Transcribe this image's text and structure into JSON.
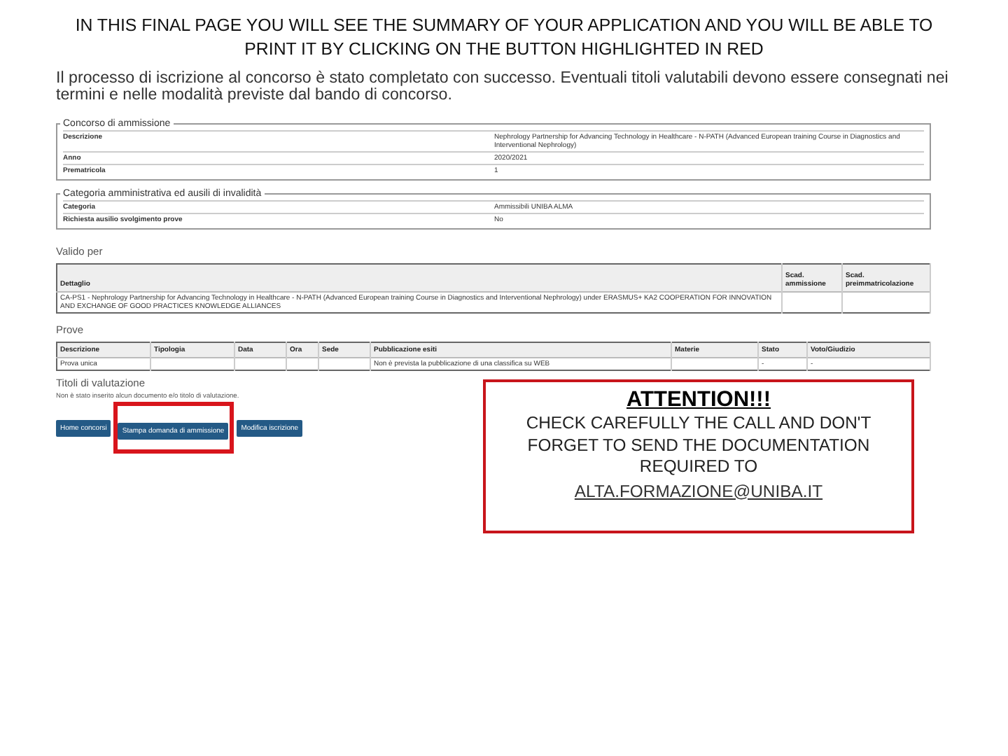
{
  "caption": "IN THIS FINAL PAGE YOU WILL SEE THE SUMMARY OF YOUR APPLICATION AND YOU WILL BE ABLE TO PRINT IT BY CLICKING ON THE BUTTON HIGHLIGHTED IN RED",
  "intro": "Il processo di iscrizione al concorso è stato completato con successo. Eventuali titoli valutabili devono essere consegnati nei termini e nelle modalità previste dal bando di concorso.",
  "panels": [
    {
      "legend": "Concorso di ammissione",
      "rows": [
        {
          "label": "Descrizione",
          "value": "Nephrology Partnership for Advancing Technology in Healthcare - N-PATH (Advanced European training Course in Diagnostics and Interventional Nephrology)"
        },
        {
          "label": "Anno",
          "value": "2020/2021"
        },
        {
          "label": "Prematricola",
          "value": "1"
        }
      ]
    },
    {
      "legend": "Categoria amministrativa ed ausili di invalidità",
      "rows": [
        {
          "label": "Categoria",
          "value": "Ammissibili UNIBA ALMA"
        },
        {
          "label": "Richiesta ausilio svolgimento prove",
          "value": "No"
        }
      ]
    }
  ],
  "tables": [
    {
      "title": "Valido per",
      "columns": [
        "Dettaglio",
        "Scad. ammissione",
        "Scad. preimmatricolazione"
      ],
      "rows": [
        [
          "CA-PS1 - Nephrology Partnership for Advancing Technology in Healthcare - N-PATH (Advanced European training Course in Diagnostics and Interventional Nephrology) under ERASMUS+ KA2 COOPERATION FOR INNOVATION AND EXCHANGE OF GOOD PRACTICES KNOWLEDGE ALLIANCES",
          "",
          ""
        ]
      ]
    },
    {
      "title": "Prove",
      "columns": [
        "Descrizione",
        "Tipologia",
        "Data",
        "Ora",
        "Sede",
        "Pubblicazione esiti",
        "Materie",
        "Stato",
        "Voto/Giudizio"
      ],
      "rows": [
        [
          "Prova unica",
          "",
          "",
          "",
          "",
          "Non è prevista la pubblicazione di una classifica su WEB",
          "",
          "-",
          "-"
        ]
      ]
    }
  ],
  "titoli": {
    "title": "Titoli di valutazione",
    "note": "Non è stato inserito alcun documento e/o titolo di valutazione.",
    "buttons": [
      {
        "label": "Home concorsi",
        "highlighted": false
      },
      {
        "label": "Stampa domanda di ammissione",
        "highlighted": true
      },
      {
        "label": "Modifica iscrizione",
        "highlighted": false
      }
    ]
  },
  "notice": {
    "title": "ATTENTION!!!",
    "text": "CHECK CAREFULLY THE CALL AND DON'T FORGET TO SEND THE DOCUMENTATION REQUIRED TO",
    "link": "ALTA.FORMAZIONE@UNIBA.IT"
  }
}
